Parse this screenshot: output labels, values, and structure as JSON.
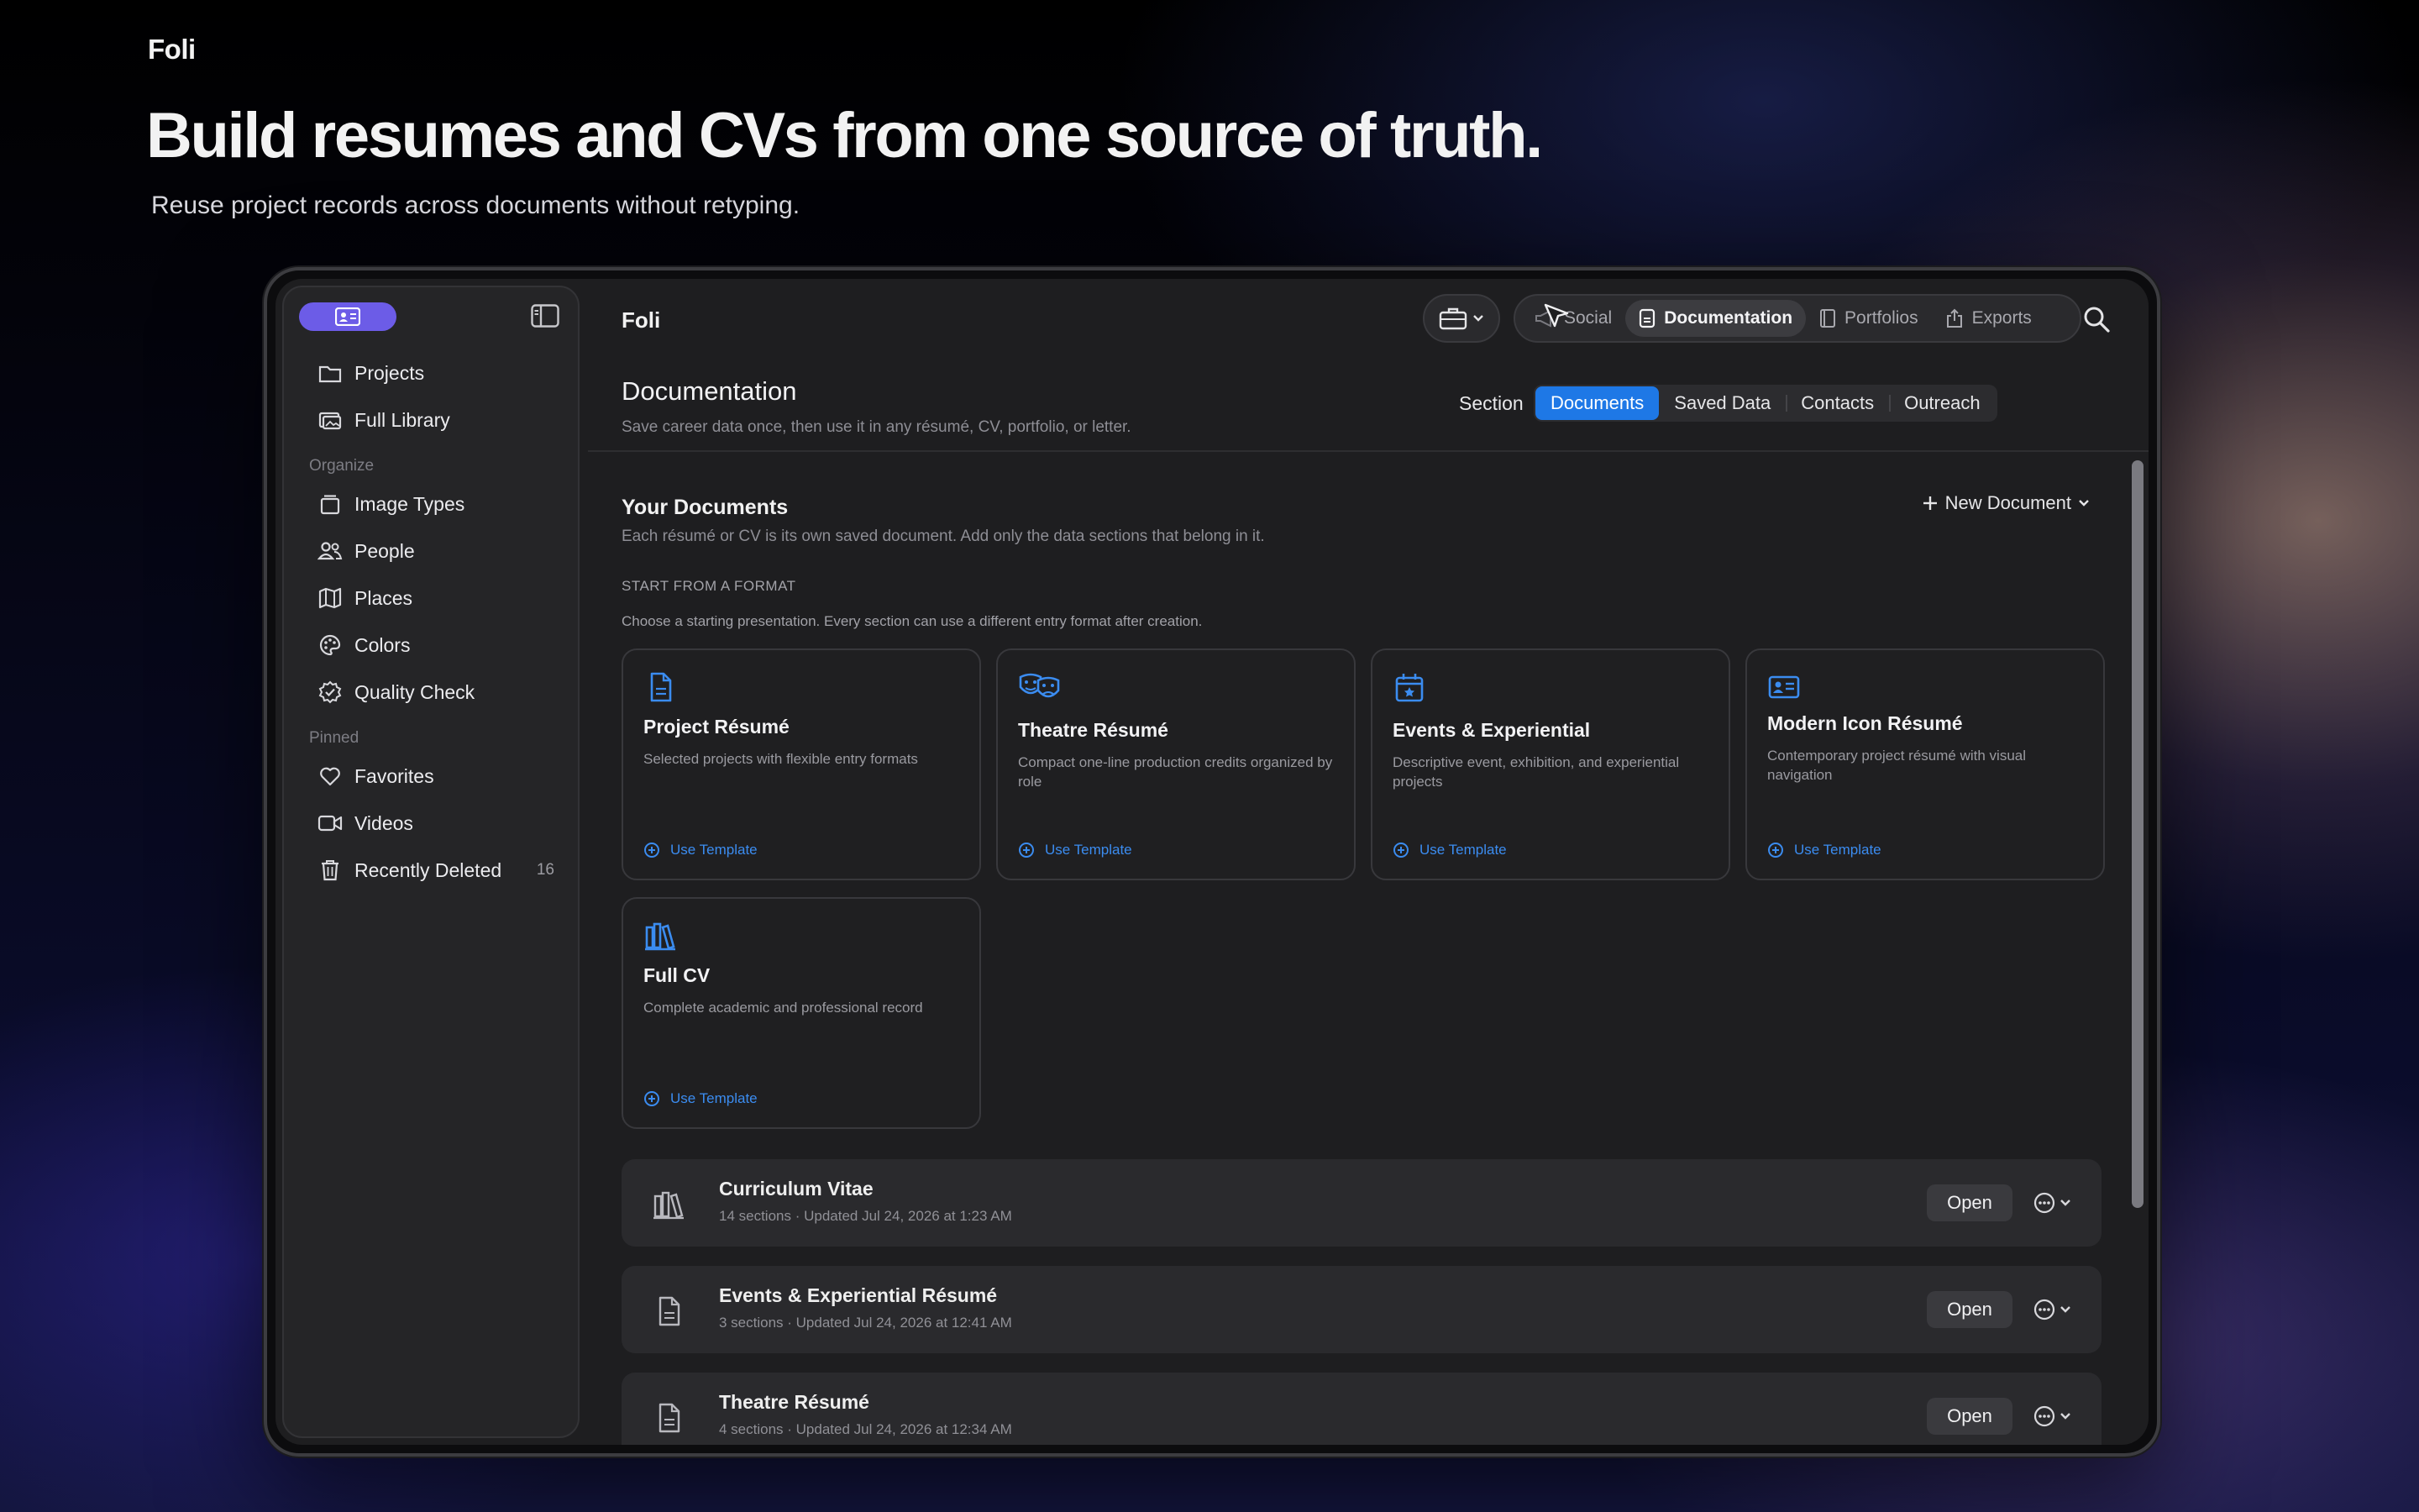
{
  "hero": {
    "brand": "Foli",
    "headline": "Build resumes and CVs from one source of truth.",
    "subline": "Reuse project records across documents without retyping."
  },
  "sidebar": {
    "top_items": [
      {
        "label": "Projects",
        "icon": "folder-icon"
      },
      {
        "label": "Full Library",
        "icon": "photo-library-icon"
      }
    ],
    "organize_label": "Organize",
    "organize_items": [
      {
        "label": "Image Types",
        "icon": "stack-icon"
      },
      {
        "label": "People",
        "icon": "people-icon"
      },
      {
        "label": "Places",
        "icon": "map-icon"
      },
      {
        "label": "Colors",
        "icon": "palette-icon"
      },
      {
        "label": "Quality Check",
        "icon": "check-seal-icon"
      }
    ],
    "pinned_label": "Pinned",
    "pinned_items": [
      {
        "label": "Favorites",
        "icon": "heart-icon"
      },
      {
        "label": "Videos",
        "icon": "video-icon"
      },
      {
        "label": "Recently Deleted",
        "icon": "trash-icon",
        "count": "16"
      }
    ]
  },
  "topbar": {
    "title": "Foli",
    "tabs": [
      {
        "label": "Social",
        "icon": "megaphone-icon"
      },
      {
        "label": "Documentation",
        "icon": "document-icon",
        "active": true
      },
      {
        "label": "Portfolios",
        "icon": "book-icon"
      },
      {
        "label": "Exports",
        "icon": "share-icon"
      }
    ]
  },
  "header": {
    "title": "Documentation",
    "description": "Save career data once, then use it in any résumé, CV, portfolio, or letter.",
    "section_label": "Section",
    "sections": [
      {
        "label": "Documents",
        "active": true
      },
      {
        "label": "Saved Data"
      },
      {
        "label": "Contacts"
      },
      {
        "label": "Outreach"
      }
    ]
  },
  "documents": {
    "title": "Your Documents",
    "description": "Each résumé or CV is its own saved document. Add only the data sections that belong in it.",
    "new_button": "New Document",
    "format_label": "START FROM A FORMAT",
    "format_description": "Choose a starting presentation. Every section can use a different entry format after creation.",
    "use_template_label": "Use Template",
    "templates": [
      {
        "title": "Project Résumé",
        "description": "Selected projects with flexible entry formats",
        "icon": "document-icon"
      },
      {
        "title": "Theatre Résumé",
        "description": "Compact one-line production credits organized by role",
        "icon": "theater-masks-icon"
      },
      {
        "title": "Events & Experiential",
        "description": "Descriptive event, exhibition, and experiential projects",
        "icon": "calendar-star-icon"
      },
      {
        "title": "Modern Icon Résumé",
        "description": "Contemporary project résumé with visual navigation",
        "icon": "id-card-icon"
      },
      {
        "title": "Full CV",
        "description": "Complete academic and professional record",
        "icon": "books-icon"
      }
    ],
    "open_label": "Open",
    "saved": [
      {
        "title": "Curriculum Vitae",
        "meta": "14 sections · Updated Jul 24, 2026 at 1:23 AM",
        "icon": "books-icon"
      },
      {
        "title": "Events & Experiential Résumé",
        "meta": "3 sections · Updated Jul 24, 2026 at 12:41 AM",
        "icon": "document-icon"
      },
      {
        "title": "Theatre Résumé",
        "meta": "4 sections · Updated Jul 24, 2026 at 12:34 AM",
        "icon": "document-icon"
      }
    ]
  },
  "colors": {
    "accent": "#1e78e6",
    "brand_purple": "#6c5ce7",
    "link_blue": "#3b8cf0"
  }
}
